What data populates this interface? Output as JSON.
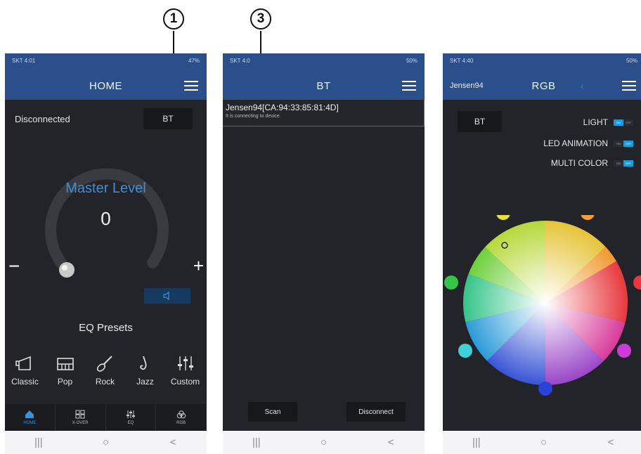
{
  "annotations": {
    "callout_1": "1",
    "callout_3": "3"
  },
  "nav_bar": {
    "recent": "|||",
    "home": "○",
    "back": "<"
  },
  "panel_home": {
    "status_left": "SKT 4:01",
    "status_right": "47%",
    "title": "HOME",
    "connection_status": "Disconnected",
    "bt_button": "BT",
    "master_label": "Master Level",
    "master_value": "0",
    "minus": "−",
    "plus": "+",
    "eq_title": "EQ Presets",
    "presets": [
      "Classic",
      "Pop",
      "Rock",
      "Jazz",
      "Custom"
    ],
    "tabs": [
      "HOME",
      "X-OVER",
      "EQ",
      "RGB"
    ]
  },
  "panel_bt": {
    "status_left": "SKT 4:0",
    "status_right": "50%",
    "title": "BT",
    "device_name": "Jensen94[CA:94:33:85:81:4D]",
    "device_status": "It is connecting to device.",
    "scan_button": "Scan",
    "disconnect_button": "Disconnect"
  },
  "panel_rgb": {
    "status_left": "SKT 4:40",
    "status_right": "50%",
    "device_name": "Jensen94",
    "title": "RGB",
    "bt_button": "BT",
    "toggles": [
      {
        "label": "LIGHT",
        "on": "ON",
        "off": "OFF",
        "state": "on"
      },
      {
        "label": "LED ANIMATION",
        "on": "ON",
        "off": "OFF",
        "state": "off"
      },
      {
        "label": "MULTI COLOR",
        "on": "ON",
        "off": "OFF",
        "state": "off"
      }
    ]
  },
  "colors": {
    "app_bar": "#2a4f8a",
    "background": "#23242a",
    "accent": "#3e8fd6",
    "toggle_on": "#1f9bd8"
  }
}
